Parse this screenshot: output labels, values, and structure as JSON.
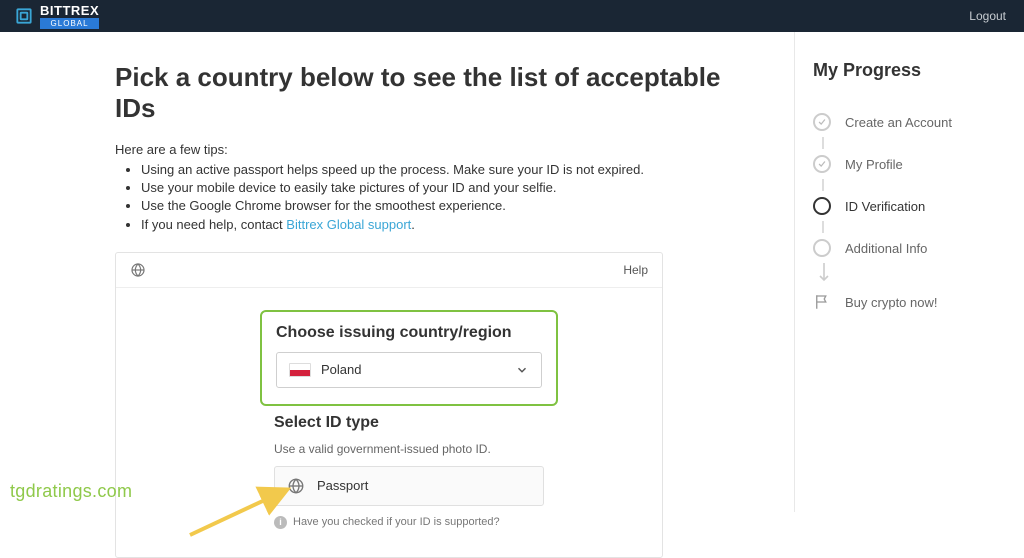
{
  "header": {
    "brand_main": "BITTREX",
    "brand_sub": "GLOBAL",
    "logout": "Logout"
  },
  "main": {
    "title": "Pick a country below to see the list of acceptable IDs",
    "tips_intro": "Here are a few tips:",
    "tips": {
      "t1": "Using an active passport helps speed up the process. Make sure your ID is not expired.",
      "t2": "Use your mobile device to easily take pictures of your ID and your selfie.",
      "t3": "Use the Google Chrome browser for the smoothest experience.",
      "t4_a": "If you need help, contact ",
      "t4_link": "Bittrex Global support",
      "t4_b": "."
    }
  },
  "card": {
    "help": "Help",
    "choose_title": "Choose issuing country/region",
    "country": "Poland",
    "select_title": "Select ID type",
    "select_sub": "Use a valid government-issued photo ID.",
    "option_passport": "Passport",
    "hint": "Have you checked if your ID is supported?"
  },
  "progress": {
    "title": "My Progress",
    "s1": "Create an Account",
    "s2": "My Profile",
    "s3": "ID Verification",
    "s4": "Additional Info",
    "buy": "Buy crypto now!"
  },
  "watermark": "tgdratings.com"
}
